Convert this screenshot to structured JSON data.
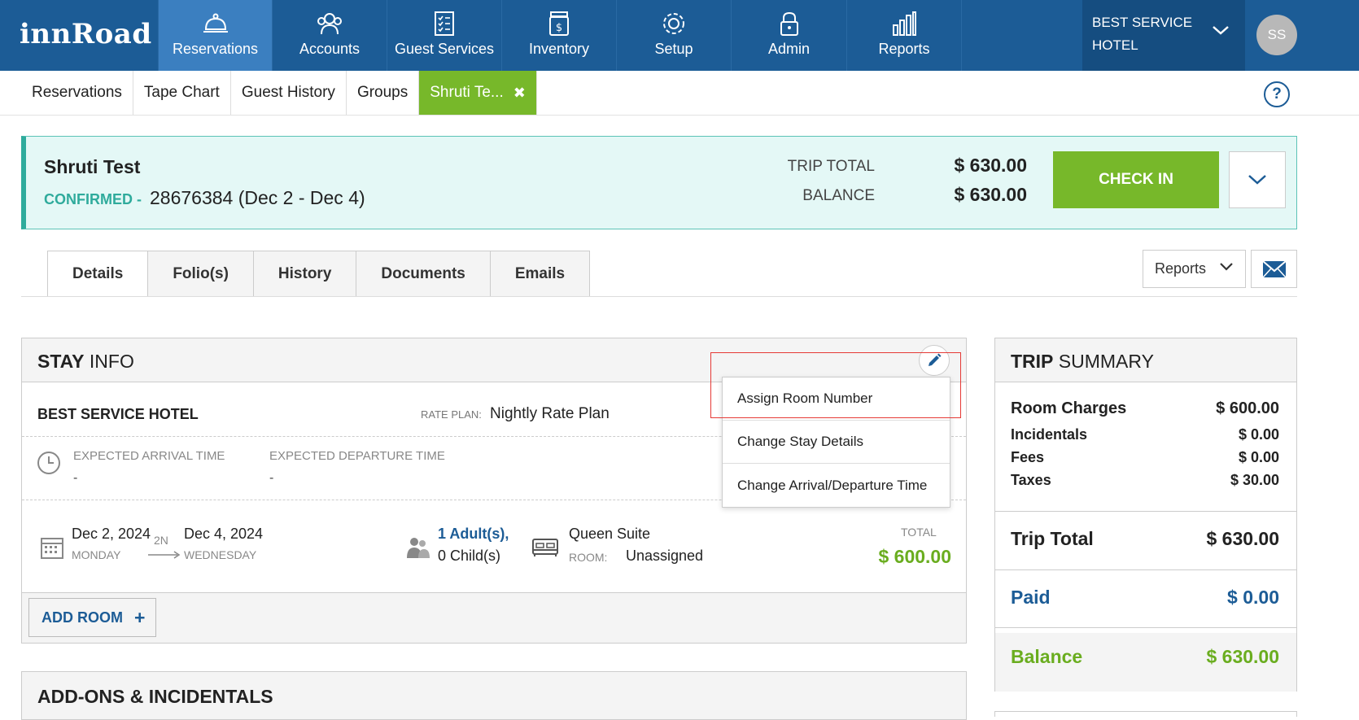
{
  "app": {
    "logo": "innRoad"
  },
  "nav": {
    "items": [
      {
        "label": "Reservations",
        "icon": "bell-icon"
      },
      {
        "label": "Accounts",
        "icon": "people-icon"
      },
      {
        "label": "Guest Services",
        "icon": "checklist-icon"
      },
      {
        "label": "Inventory",
        "icon": "jar-icon"
      },
      {
        "label": "Setup",
        "icon": "gear-icon"
      },
      {
        "label": "Admin",
        "icon": "lock-icon"
      },
      {
        "label": "Reports",
        "icon": "bar-chart-icon"
      }
    ],
    "hotel_name": "BEST SERVICE HOTEL",
    "avatar_initials": "SS"
  },
  "subtabs": {
    "items": [
      "Reservations",
      "Tape Chart",
      "Guest History",
      "Groups"
    ],
    "active_tab": "Shruti Te...",
    "close_glyph": "✖",
    "help_glyph": "?"
  },
  "reservation": {
    "guest_name": "Shruti Test",
    "status": "CONFIRMED -",
    "number_dates": "28676384 (Dec 2 - Dec 4)",
    "trip_total_label": "TRIP TOTAL",
    "trip_total": "$ 630.00",
    "balance_label": "BALANCE",
    "balance": "$ 630.00",
    "checkin_label": "CHECK IN"
  },
  "detail_tabs": [
    "Details",
    "Folio(s)",
    "History",
    "Documents",
    "Emails"
  ],
  "toolbar": {
    "reports_label": "Reports"
  },
  "stay_info": {
    "title_bold": "STAY",
    "title_rest": " INFO",
    "hotel": "BEST SERVICE HOTEL",
    "rate_plan_label": "RATE PLAN:",
    "rate_plan": "Nightly Rate Plan",
    "arrival_time_label": "EXPECTED ARRIVAL TIME",
    "arrival_time": "-",
    "departure_time_label": "EXPECTED DEPARTURE TIME",
    "departure_time": "-",
    "checkin_date": "Dec 2, 2024",
    "checkin_day": "MONDAY",
    "nights": "2N",
    "checkout_date": "Dec 4, 2024",
    "checkout_day": "WEDNESDAY",
    "adults": "1 Adult(s),",
    "children": "0 Child(s)",
    "room_type": "Queen Suite",
    "room_label": "ROOM:",
    "room_value": "Unassigned",
    "total_label": "TOTAL",
    "total": "$ 600.00",
    "add_room_label": "ADD ROOM",
    "add_room_glyph": "+"
  },
  "edit_menu": {
    "items": [
      "Assign Room Number",
      "Change Stay Details",
      "Change Arrival/Departure Time"
    ]
  },
  "addons": {
    "title": "ADD-ONS & INCIDENTALS"
  },
  "trip_summary": {
    "title_bold": "TRIP",
    "title_rest": " SUMMARY",
    "room_charges_label": "Room Charges",
    "room_charges": "$ 600.00",
    "incidentals_label": "Incidentals",
    "incidentals": "$ 0.00",
    "fees_label": "Fees",
    "fees": "$ 0.00",
    "taxes_label": "Taxes",
    "taxes": "$ 30.00",
    "trip_total_label": "Trip Total",
    "trip_total": "$ 630.00",
    "paid_label": "Paid",
    "paid": "$ 0.00",
    "balance_label": "Balance",
    "balance": "$ 630.00"
  },
  "colors": {
    "nav_blue": "#1c5c96",
    "active_nav": "#3b7fc0",
    "green": "#77b82a",
    "teal": "#2fab9c",
    "highlight_red": "#e53935"
  }
}
